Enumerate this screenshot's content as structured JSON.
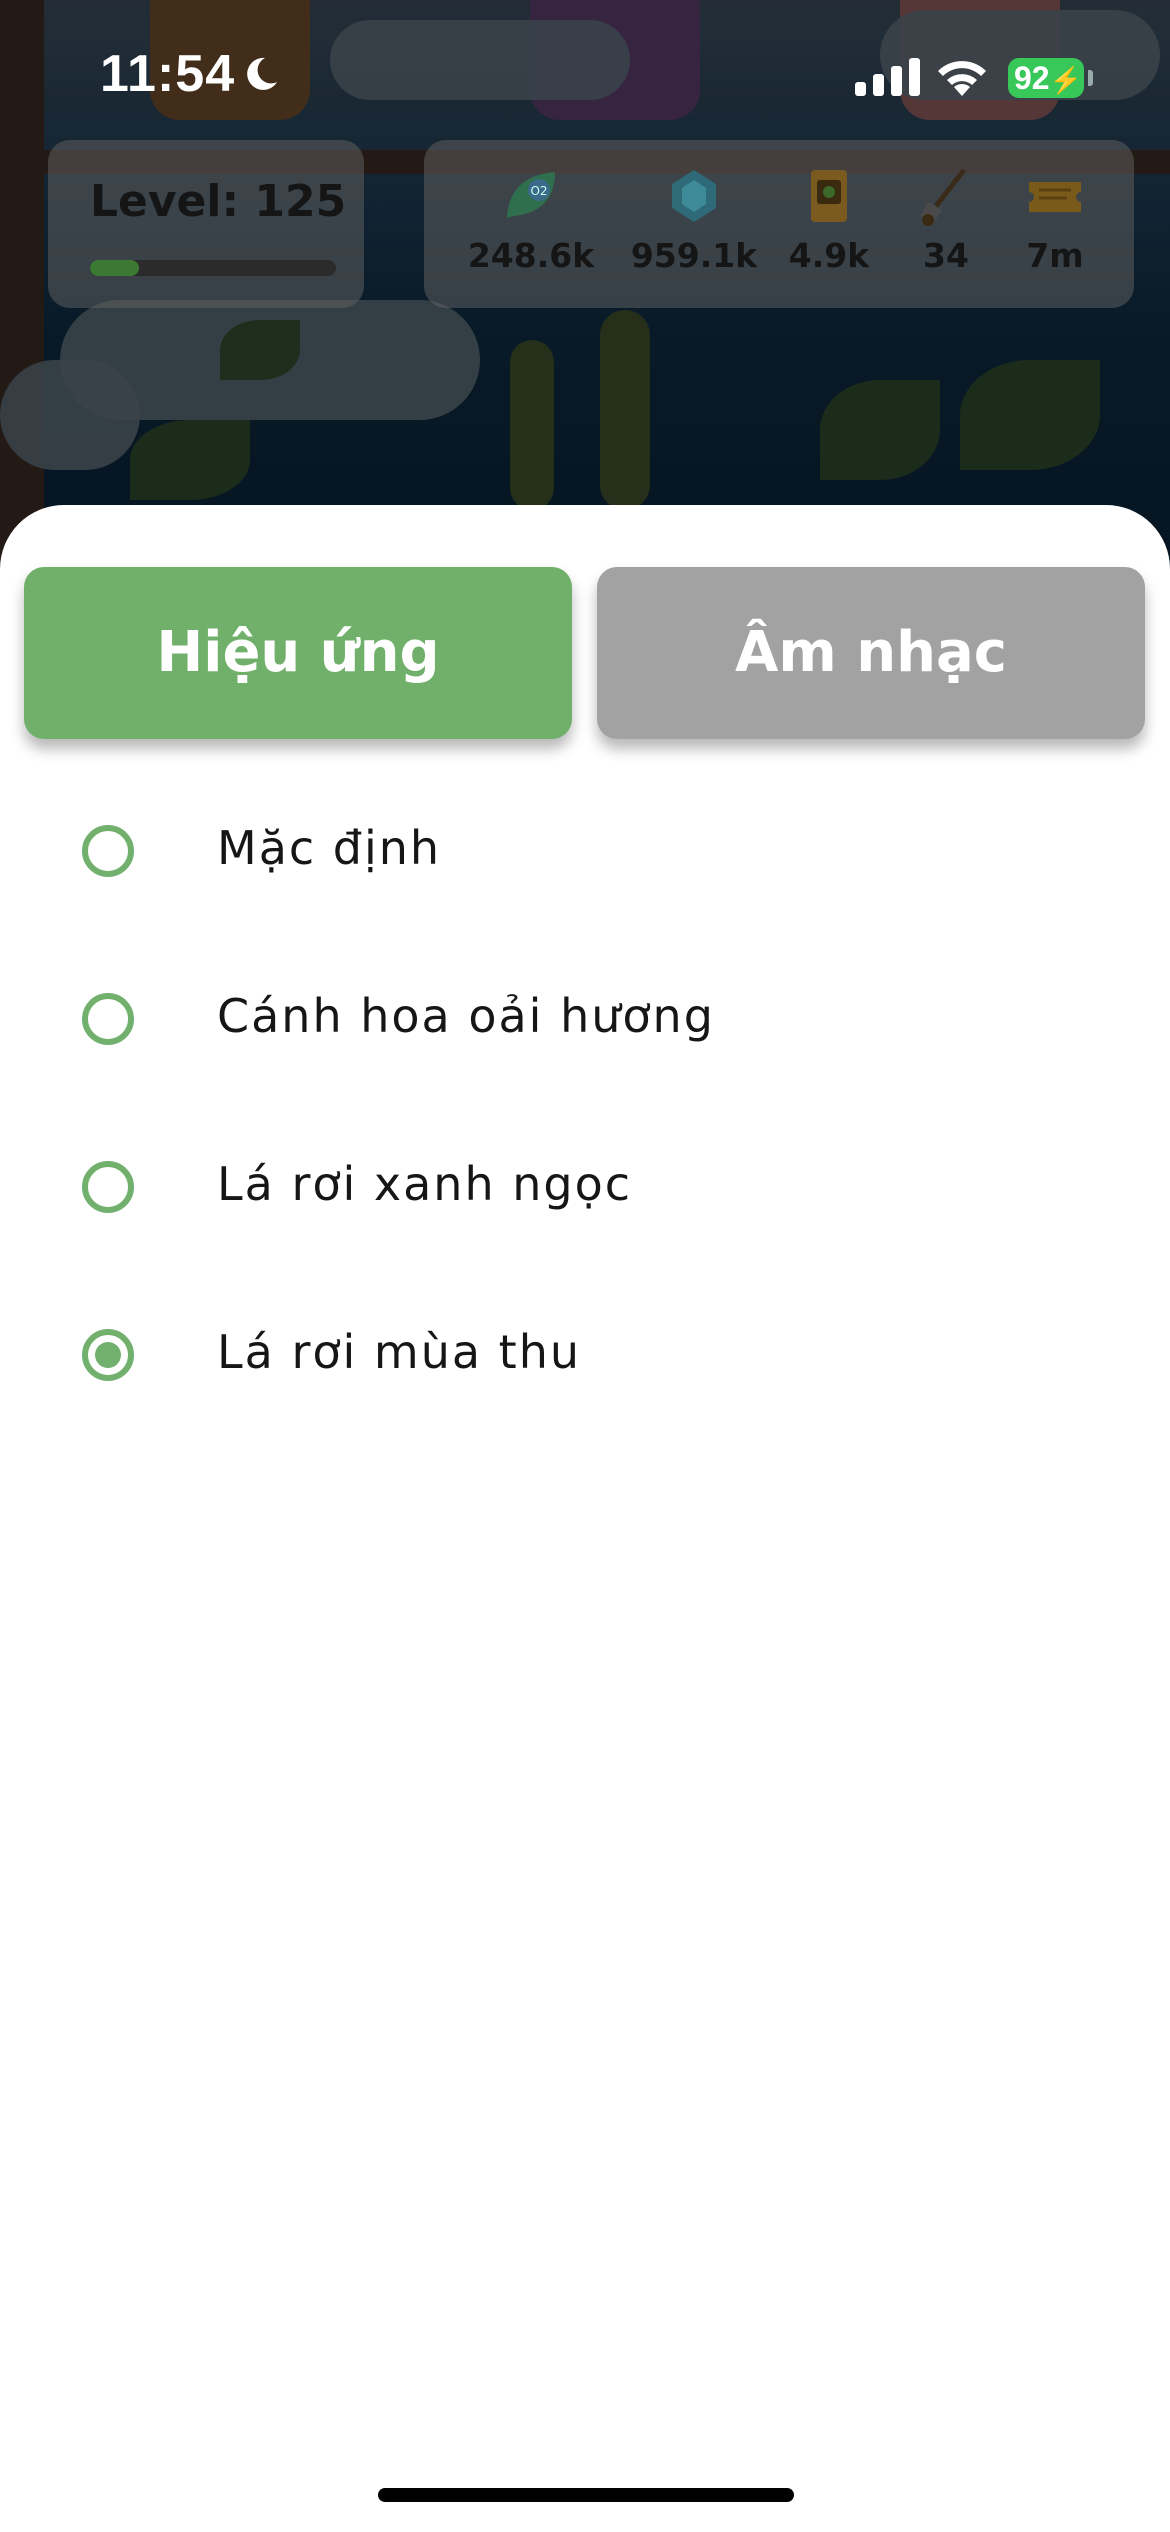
{
  "status_bar": {
    "time": "11:54",
    "battery_percent": "92",
    "icons": [
      "moon-icon",
      "cellular-signal-icon",
      "wifi-icon",
      "battery-charging-icon"
    ]
  },
  "level": {
    "label": "Level: 125",
    "progress": 0.2
  },
  "resources": [
    {
      "icon": "oxygen-leaf-icon",
      "value": "248.6k"
    },
    {
      "icon": "gem-icon",
      "value": "959.1k"
    },
    {
      "icon": "seed-bag-icon",
      "value": "4.9k"
    },
    {
      "icon": "shovel-icon",
      "value": "34"
    },
    {
      "icon": "ticket-icon",
      "value": "7m"
    }
  ],
  "tabs": {
    "effects_label": "Hiệu ứng",
    "music_label": "Âm nhạc",
    "active": "effects"
  },
  "options": [
    {
      "label": "Mặc định",
      "selected": false
    },
    {
      "label": "Cánh hoa oải hương",
      "selected": false
    },
    {
      "label": "Lá rơi xanh ngọc",
      "selected": false
    },
    {
      "label": "Lá rơi mùa thu",
      "selected": true
    }
  ],
  "colors": {
    "accent_green": "#70b06b",
    "inactive_gray": "#a2a2a2",
    "battery_green": "#38c759"
  }
}
